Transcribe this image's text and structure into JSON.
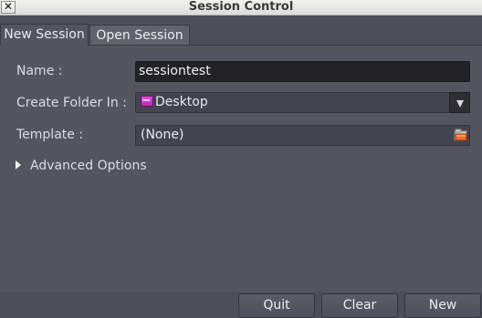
{
  "window": {
    "title": "Session Control",
    "close_label": "✕"
  },
  "tabs": [
    {
      "label": "New Session",
      "active": true
    },
    {
      "label": "Open Session",
      "active": false
    }
  ],
  "form": {
    "name_label": "Name :",
    "name_value": "sessiontest",
    "folder_label": "Create Folder In :",
    "folder_value": "Desktop",
    "template_label": "Template :",
    "template_value": "(None)",
    "advanced_label": "Advanced Options"
  },
  "buttons": {
    "quit": "Quit",
    "clear": "Clear",
    "new": "New"
  },
  "icons": {
    "close": "close-icon",
    "folder": "folder-icon",
    "dropdown": "chevron-down-icon",
    "open_file": "open-file-icon",
    "expander": "triangle-right-icon"
  }
}
